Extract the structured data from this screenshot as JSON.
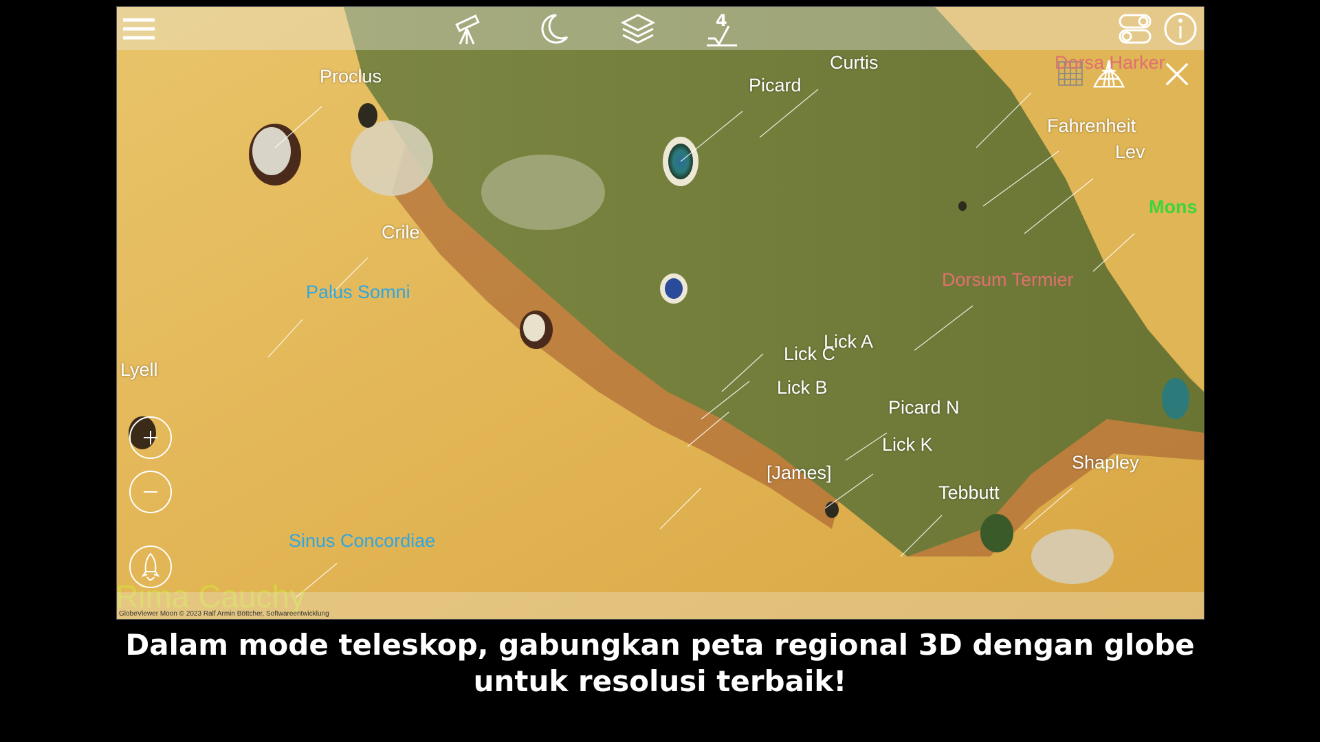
{
  "toolbar": {
    "menu_icon": "hamburger-menu-icon",
    "telescope_icon": "telescope-icon",
    "moon_icon": "crescent-moon-icon",
    "layers_icon": "layers-icon",
    "level_value": "4",
    "settings_icon": "toggle-settings-icon",
    "info_icon": "info-icon"
  },
  "overlay_controls": {
    "grid_icon": "grid-icon",
    "globe_icon": "globe-grid-icon",
    "close_icon": "close-icon",
    "zoom_in_icon": "zoom-in-icon",
    "zoom_out_icon": "zoom-out-icon",
    "rocket_icon": "rocket-launch-icon"
  },
  "labels": {
    "proclus": "Proclus",
    "curtis": "Curtis",
    "picard": "Picard",
    "dorsa_harker": "Dorsa Harker",
    "fahrenheit": "Fahrenheit",
    "lev": "Lev",
    "mons": "Mons",
    "crile": "Crile",
    "palus_somni": "Palus Somni",
    "dorsum_termier": "Dorsum Termier",
    "lyell": "Lyell",
    "lick_a": "Lick A",
    "lick_c": "Lick C",
    "lick_b": "Lick B",
    "picard_n": "Picard N",
    "lick_k": "Lick K",
    "james": "[James]",
    "shapley": "Shapley",
    "tebbutt": "Tebbutt",
    "sinus_concordiae": "Sinus Concordiae",
    "rima_cauchy": "Rima Cauchy"
  },
  "credit": "GlobeViewer Moon © 2023 Ralf Armin Böttcher, Softwareentwicklung",
  "caption": {
    "line1": "Dalam mode teleskop, gabungkan peta regional 3D dengan globe",
    "line2": "untuk resolusi terbaik!"
  },
  "colors": {
    "mare_green": "#6f7a3a",
    "highland_yellow": "#e0b85a",
    "ridge_brown": "#8a4a2a",
    "label_blue": "#2fa6e0",
    "label_red": "#e07070",
    "label_green": "#3ed43e"
  }
}
